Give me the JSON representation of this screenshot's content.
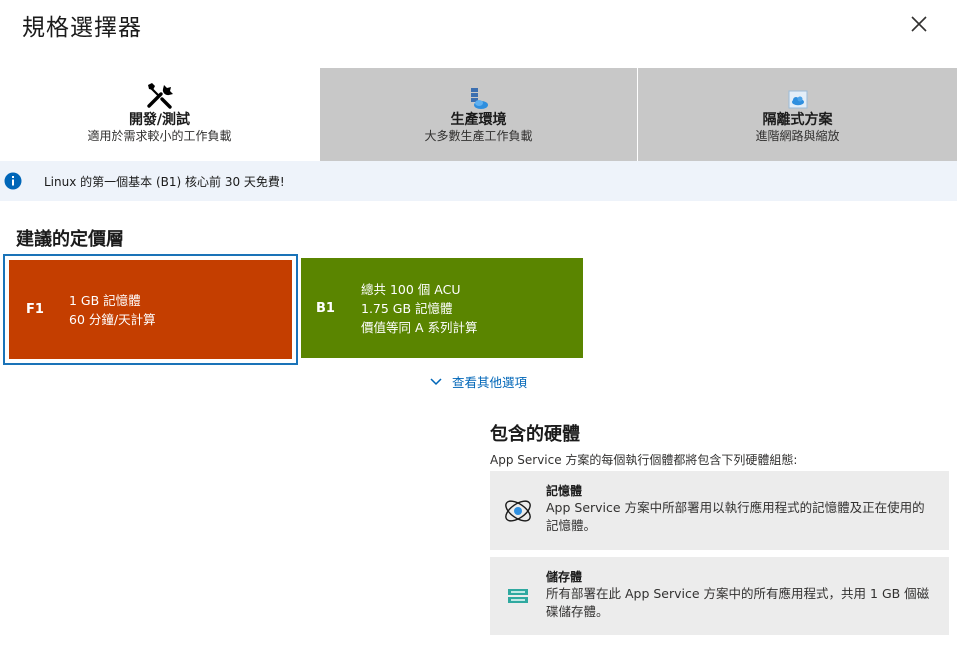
{
  "header": {
    "title": "規格選擇器",
    "close_icon": "close-icon"
  },
  "tabs": [
    {
      "name": "開發/測試",
      "subtitle": "適用於需求較小的工作負載",
      "icon": "tools-icon",
      "active": true
    },
    {
      "name": "生產環境",
      "subtitle": "大多數生產工作負載",
      "icon": "server-icon",
      "active": false
    },
    {
      "name": "隔離式方案",
      "subtitle": "進階網路與縮放",
      "icon": "isolated-cloud-icon",
      "active": false
    }
  ],
  "info_banner": {
    "icon": "info-icon",
    "text": "Linux 的第一個基本 (B1) 核心前 30 天免費!"
  },
  "recommended": {
    "title": "建議的定價層",
    "tiers": [
      {
        "code": "F1",
        "lines": [
          "1 GB 記憶體",
          "60 分鐘/天計算"
        ],
        "color": "#c43e00",
        "selected": true
      },
      {
        "code": "B1",
        "lines": [
          "總共 100 個 ACU",
          "1.75 GB 記憶體",
          "價值等同 A 系列計算"
        ],
        "color": "#5a8500",
        "selected": false
      }
    ],
    "more_options": "查看其他選項"
  },
  "hardware": {
    "title": "包含的硬體",
    "subtitle": "App Service 方案的每個執行個體都將包含下列硬體組態:",
    "items": [
      {
        "name": "記憶體",
        "description_line1": "App Service 方案中所部署用以執行應用程式的記憶體及正在使用的",
        "description_line2": "記憶體。",
        "icon": "memory-icon"
      },
      {
        "name": "儲存體",
        "description_line1": "所有部署在此 App Service 方案中的所有應用程式，共用 1 GB 個磁",
        "description_line2": "碟儲存體。",
        "icon": "storage-icon"
      }
    ]
  },
  "colors": {
    "accent": "#0066b8",
    "selected_border": "#1a73b8",
    "info_bg": "#eef3fa"
  }
}
